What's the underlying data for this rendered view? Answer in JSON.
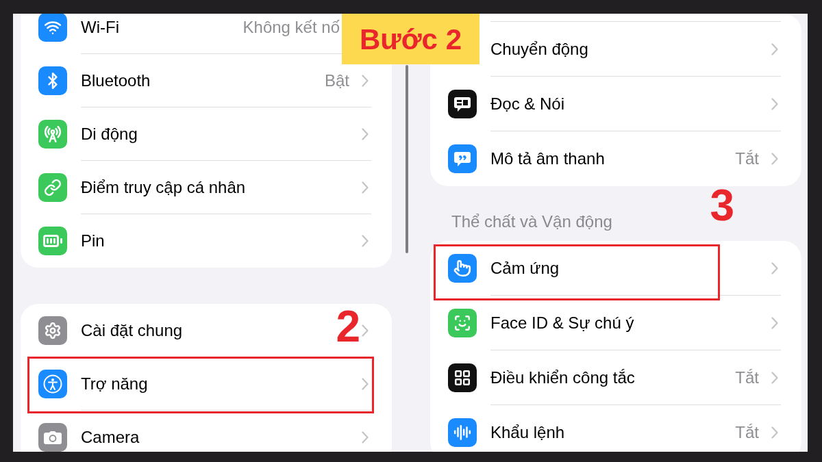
{
  "step_label": "Bước 2",
  "left_panel": {
    "groups": [
      {
        "rows": [
          {
            "label": "Wi-Fi",
            "value": "Không kết nố",
            "chevron": false,
            "highlighted": false
          },
          {
            "label": "Bluetooth",
            "value": "Bật",
            "chevron": true,
            "highlighted": false
          },
          {
            "label": "Di động",
            "chevron": true,
            "highlighted": false
          },
          {
            "label": "Điểm truy cập cá nhân",
            "chevron": true,
            "highlighted": false
          },
          {
            "label": "Pin",
            "chevron": true,
            "highlighted": false
          }
        ]
      },
      {
        "rows": [
          {
            "label": "Cài đặt chung",
            "chevron": true,
            "highlighted": false
          },
          {
            "label": "Trợ năng",
            "chevron": true,
            "highlighted": true,
            "callout": "2"
          },
          {
            "label": "Camera",
            "chevron": true,
            "highlighted": false
          }
        ]
      }
    ]
  },
  "right_panel": {
    "groups": [
      {
        "rows": [
          {
            "label": "Chuyển động",
            "chevron": true,
            "highlighted": false
          },
          {
            "label": "Đọc & Nói",
            "chevron": true,
            "highlighted": false
          },
          {
            "label": "Mô tả âm thanh",
            "value": "Tắt",
            "chevron": true,
            "highlighted": false
          }
        ]
      },
      {
        "header": "Thể chất và Vận động",
        "rows": [
          {
            "label": "Cảm ứng",
            "chevron": true,
            "highlighted": true,
            "callout": "3"
          },
          {
            "label": "Face ID & Sự chú ý",
            "chevron": true,
            "highlighted": false
          },
          {
            "label": "Điều khiển công tắc",
            "value": "Tắt",
            "chevron": true,
            "highlighted": false
          },
          {
            "label": "Khẩu lệnh",
            "value": "Tắt",
            "chevron": true,
            "highlighted": false
          }
        ]
      }
    ]
  }
}
